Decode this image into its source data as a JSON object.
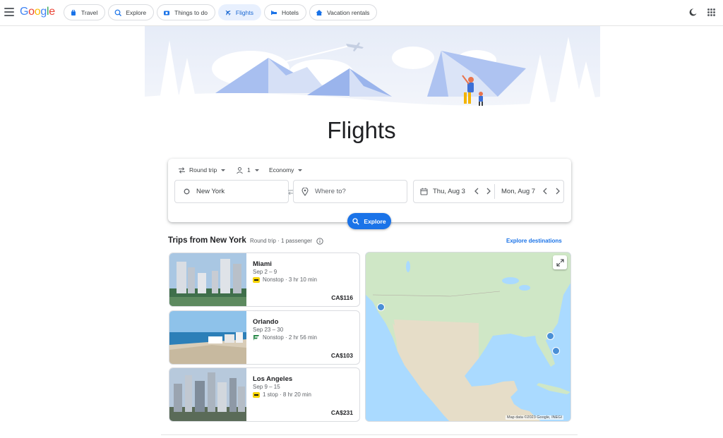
{
  "header": {
    "logo": {
      "g1": "G",
      "o1": "o",
      "o2": "o",
      "g2": "g",
      "l": "l",
      "e": "e"
    },
    "tabs": [
      {
        "label": "Travel",
        "icon": "suitcase-icon",
        "active": false
      },
      {
        "label": "Explore",
        "icon": "explore-icon",
        "active": false
      },
      {
        "label": "Things to do",
        "icon": "camera-icon",
        "active": false
      },
      {
        "label": "Flights",
        "icon": "airplane-icon",
        "active": true
      },
      {
        "label": "Hotels",
        "icon": "bed-icon",
        "active": false
      },
      {
        "label": "Vacation rentals",
        "icon": "house-icon",
        "active": false
      }
    ]
  },
  "hero": {
    "title": "Flights"
  },
  "search": {
    "trip_type": "Round trip",
    "passengers": "1",
    "cabin": "Economy",
    "origin": "New York",
    "destination_placeholder": "Where to?",
    "depart_date": "Thu, Aug 3",
    "return_date": "Mon, Aug 7",
    "explore_label": "Explore"
  },
  "trips": {
    "title": "Trips from New York",
    "subtitle": "Round trip · 1 passenger",
    "explore_destinations": "Explore destinations",
    "cards": [
      {
        "city": "Miami",
        "dates": "Sep 2 – 9",
        "flight": "Nonstop · 3 hr 10 min",
        "price": "CA$116"
      },
      {
        "city": "Orlando",
        "dates": "Sep 23 – 30",
        "flight": "Nonstop · 2 hr 56 min",
        "price": "CA$103"
      },
      {
        "city": "Los Angeles",
        "dates": "Sep 9 – 15",
        "flight": "1 stop · 8 hr 20 min",
        "price": "CA$231"
      }
    ]
  },
  "map": {
    "attribution": "Map data ©2023 Google, INEGI"
  },
  "colors": {
    "accent": "#1a73e8",
    "active_tab_bg": "#e8f0fe",
    "map_water": "#aadaff",
    "map_land": "#cfe7c6"
  }
}
